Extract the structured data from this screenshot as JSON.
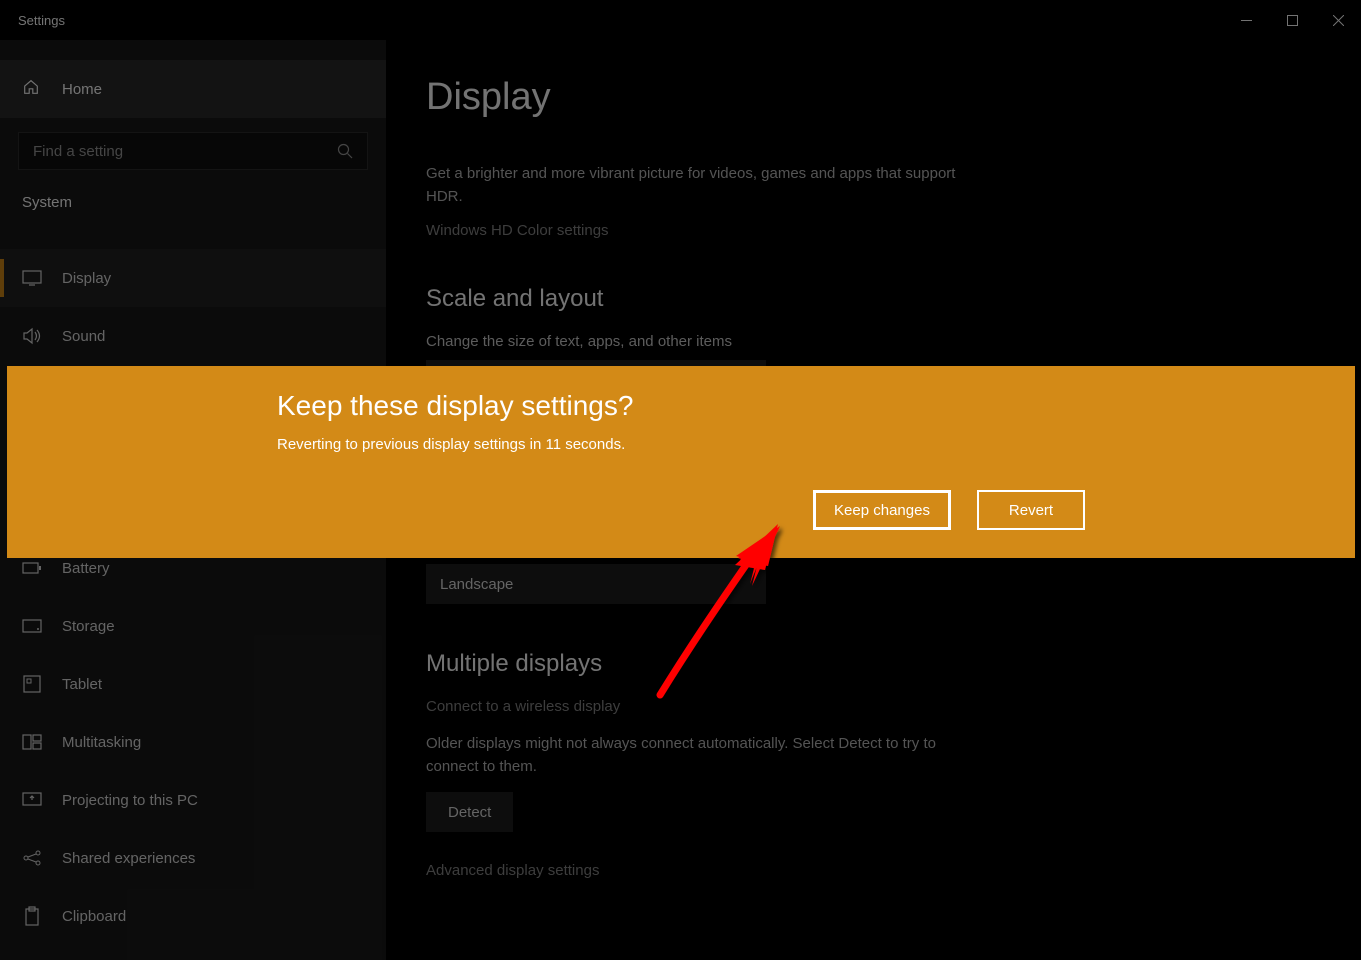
{
  "window": {
    "title": "Settings"
  },
  "sidebar": {
    "home": "Home",
    "search_placeholder": "Find a setting",
    "category": "System",
    "items": [
      {
        "label": "Display",
        "icon": "display-icon",
        "active": true
      },
      {
        "label": "Sound",
        "icon": "sound-icon"
      },
      {
        "label": "Battery",
        "icon": "battery-icon"
      },
      {
        "label": "Storage",
        "icon": "storage-icon"
      },
      {
        "label": "Tablet",
        "icon": "tablet-icon"
      },
      {
        "label": "Multitasking",
        "icon": "multitasking-icon"
      },
      {
        "label": "Projecting to this PC",
        "icon": "projecting-icon"
      },
      {
        "label": "Shared experiences",
        "icon": "shared-icon"
      },
      {
        "label": "Clipboard",
        "icon": "clipboard-icon"
      }
    ]
  },
  "main": {
    "title": "Display",
    "hdr_desc": "Get a brighter and more vibrant picture for videos, games and apps that support HDR.",
    "hdr_link": "Windows HD Color settings",
    "scale_h": "Scale and layout",
    "scale_label": "Change the size of text, apps, and other items",
    "orientation_value": "Landscape",
    "multi_h": "Multiple displays",
    "multi_link": "Connect to a wireless display",
    "multi_desc": "Older displays might not always connect automatically. Select Detect to try to connect to them.",
    "detect_btn": "Detect",
    "adv_link": "Advanced display settings"
  },
  "dialog": {
    "title": "Keep these display settings?",
    "message": "Reverting to previous display settings in 11 seconds.",
    "keep": "Keep changes",
    "revert": "Revert"
  },
  "colors": {
    "accent": "#d38a17",
    "arrow": "#ff0000"
  }
}
